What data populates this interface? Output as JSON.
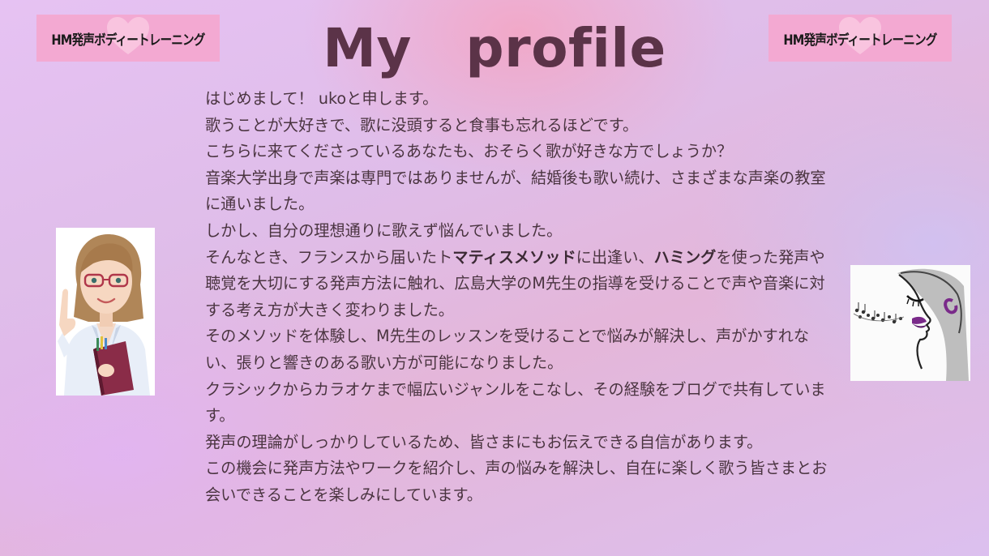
{
  "title": "My　profile",
  "badges": {
    "left": "HM発声ボディートレーニング",
    "right": "HM発声ボディートレーニング"
  },
  "icons": {
    "badge_heart": "heart-icon",
    "left_image": "teacher-illustration",
    "right_image": "singer-sketch"
  },
  "colors": {
    "title": "#5b3348",
    "badge_bg": "#f3a9d2",
    "text": "#4a3440"
  },
  "paragraphs": [
    {
      "text": "はじめまして！ ukoと申します。"
    },
    {
      "text": "歌うことが大好きで、歌に没頭すると食事も忘れるほどです。"
    },
    {
      "text": "こちらに来てくださっているあなたも、おそらく歌が好きな方でしょうか？"
    },
    {
      "text": "音楽大学出身で声楽は専門ではありませんが、結婚後も歌い続け、さまざまな声楽の教室に通いました。"
    },
    {
      "text": "しかし、自分の理想通りに歌えず悩んでいました。"
    },
    {
      "a": "そんなとき、フランスから届いたト",
      "b": "マティスメソッド",
      "c": "に出逢い、",
      "d": "ハミング",
      "e": "を使った発声や聴覚を大切にする発声方法に触れ、広島大学のM先生の指導を受けることで声や音楽に対する考え方が大きく変わりました。"
    },
    {
      "text": "そのメソッドを体験し、M先生のレッスンを受けることで悩みが解決し、声がかすれない、張りと響きのある歌い方が可能になりました。"
    },
    {
      "text": "クラシックからカラオケまで幅広いジャンルをこなし、その経験をブログで共有しています。"
    },
    {
      "text": "発声の理論がしっかりしているため、皆さまにもお伝えできる自信があります。"
    },
    {
      "text": "この機会に発声方法やワークを紹介し、声の悩みを解決し、自在に楽しく歌う皆さまとお会いできることを楽しみにしています。"
    }
  ]
}
